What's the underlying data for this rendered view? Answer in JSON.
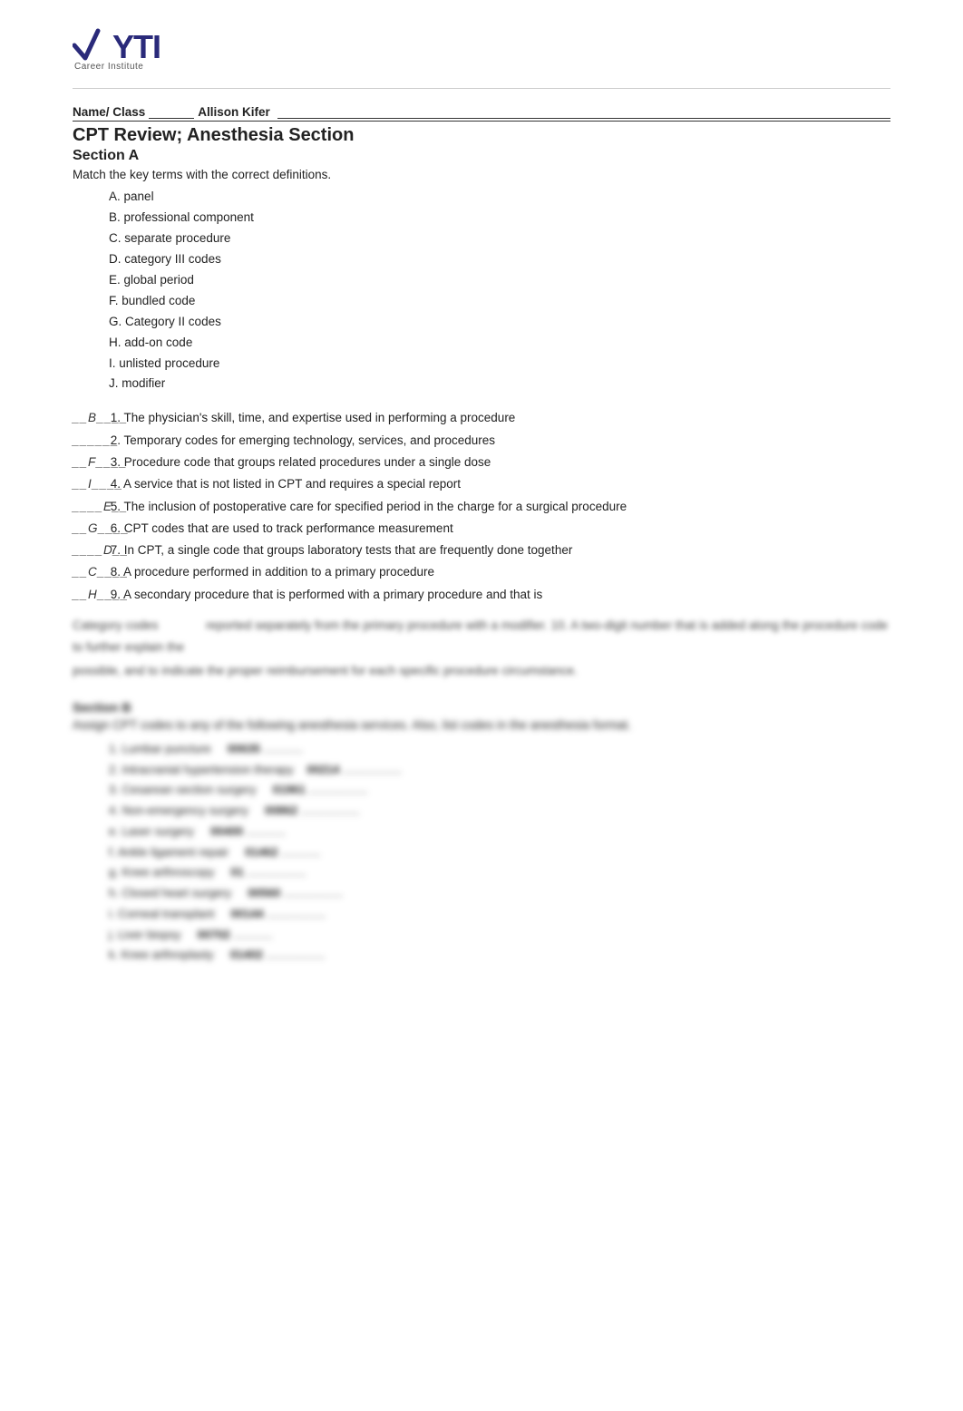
{
  "header": {
    "logo_text": "YTI",
    "logo_prefix": "V",
    "logo_subtitle": "Career Institute"
  },
  "name_line": {
    "label": "Name/ Class",
    "value": "Allison Kifer",
    "line_extension": "__________________________________________"
  },
  "doc_title": "CPT Review; Anesthesia Section",
  "section_a": {
    "title": "Section A",
    "instructions": "Match the key terms with the correct definitions.",
    "terms": [
      {
        "letter": "A.",
        "term": "panel"
      },
      {
        "letter": "B.",
        "term": "professional component"
      },
      {
        "letter": "C.",
        "term": "separate procedure"
      },
      {
        "letter": "D.",
        "term": "category III codes"
      },
      {
        "letter": "E.",
        "term": "global period"
      },
      {
        "letter": "F.",
        "term": "bundled code"
      },
      {
        "letter": "G.",
        "term": "Category II codes"
      },
      {
        "letter": "H.",
        "term": "add-on code"
      },
      {
        "letter": "I.",
        "term": "unlisted procedure"
      },
      {
        "letter": "J.",
        "term": "modifier"
      }
    ],
    "matching_items": [
      {
        "answer": "__B____",
        "text": "1. The physician's skill, time, and expertise used in performing a procedure"
      },
      {
        "answer": "______",
        "text": "2. Temporary codes for emerging technology, services, and procedures"
      },
      {
        "answer": "__F____",
        "text": "3. Procedure code that groups related procedures under a single dose"
      },
      {
        "answer": "__I____",
        "text": "4. A service that is not listed in CPT and requires a special report"
      },
      {
        "answer": "____E__",
        "text": "5. The inclusion of postoperative care for specified period in the charge for a surgical procedure"
      },
      {
        "answer": "__G____",
        "text": "6. CPT codes that are used to track performance measurement"
      },
      {
        "answer": "____D__",
        "text": "7. In CPT, a single code that groups laboratory tests that are frequently done together"
      },
      {
        "answer": "__C____",
        "text": "8. A procedure performed in addition to a primary procedure"
      },
      {
        "answer": "__H____",
        "text": "9. A secondary procedure that is performed with a primary procedure and that is"
      }
    ]
  },
  "blurred_text_1": "Category codes",
  "section_b": {
    "title": "Section B",
    "instruction": "Assign CPT codes to any of the following anesthesia services. Also, list codes in the anesthesia format.",
    "items": [
      {
        "label": "Lumbar puncture",
        "code": "00635",
        "suffix": "..."
      },
      {
        "label": "Intracranial hypertension therapy",
        "code": "00214",
        "suffix": ".................."
      },
      {
        "label": "Cesarean section surgery",
        "code": "01961",
        "suffix": ".................."
      },
      {
        "label": "Non-emergency surgery",
        "code": "00862",
        "suffix": ".................."
      },
      {
        "label": "Laser surgery",
        "code": "00400",
        "suffix": ".................."
      },
      {
        "label": "Ankle ligament repair",
        "code": "01462",
        "suffix": "............"
      },
      {
        "label": "Knee arthroscopy",
        "code": "01",
        "suffix": ".................."
      },
      {
        "label": "Closed heart surgery",
        "code": "00560",
        "suffix": ".................."
      },
      {
        "label": "Corneal transplant",
        "code": "00144",
        "suffix": ".................."
      },
      {
        "label": "Liver biopsy",
        "code": "00702",
        "suffix": "............"
      },
      {
        "label": "Knee arthroplasty",
        "code": "01402",
        "suffix": ".................."
      }
    ]
  }
}
